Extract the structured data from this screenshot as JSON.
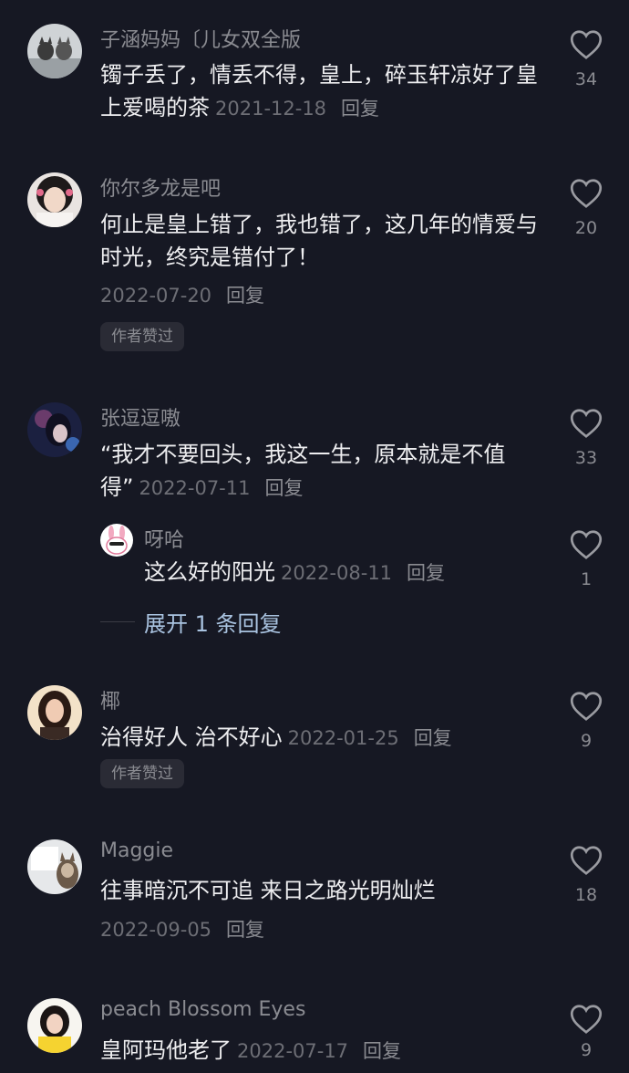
{
  "comments": [
    {
      "username": "子涵妈妈〔儿女双全版",
      "text": "镯子丢了，情丢不得，皇上，碎玉轩凉好了皇上爱喝的茶",
      "date": "2021-12-18",
      "reply": "回复",
      "likes": "34"
    },
    {
      "username": "你尔多龙是吧",
      "text": "何止是皇上错了，我也错了，这几年的情爱与时光，终究是错付了！",
      "date": "2022-07-20",
      "reply": "回复",
      "likes": "20",
      "badge": "作者赞过"
    },
    {
      "username": "张逗逗嗷",
      "text": "“我才不要回头，我这一生，原本就是不值得”",
      "date": "2022-07-11",
      "reply": "回复",
      "likes": "33",
      "sub_reply": {
        "username": "呀哈",
        "text": "这么好的阳光",
        "date": "2022-08-11",
        "reply": "回复",
        "likes": "1"
      },
      "expand_label": "展开 1 条回复"
    },
    {
      "username": "椰",
      "text": "治得好人 治不好心",
      "date": "2022-01-25",
      "reply": "回复",
      "likes": "9",
      "badge": "作者赞过"
    },
    {
      "username": "Maggie",
      "text": "往事暗沉不可追 来日之路光明灿烂",
      "date": "2022-09-05",
      "reply": "回复",
      "likes": "18"
    },
    {
      "username": "peach Blossom Eyes",
      "text": "皇阿玛他老了",
      "date": "2022-07-17",
      "reply": "回复",
      "likes": "9"
    }
  ],
  "colors": {
    "background": "#161823",
    "username": "#8a8b91",
    "link_blue": "#a9c3e0"
  }
}
